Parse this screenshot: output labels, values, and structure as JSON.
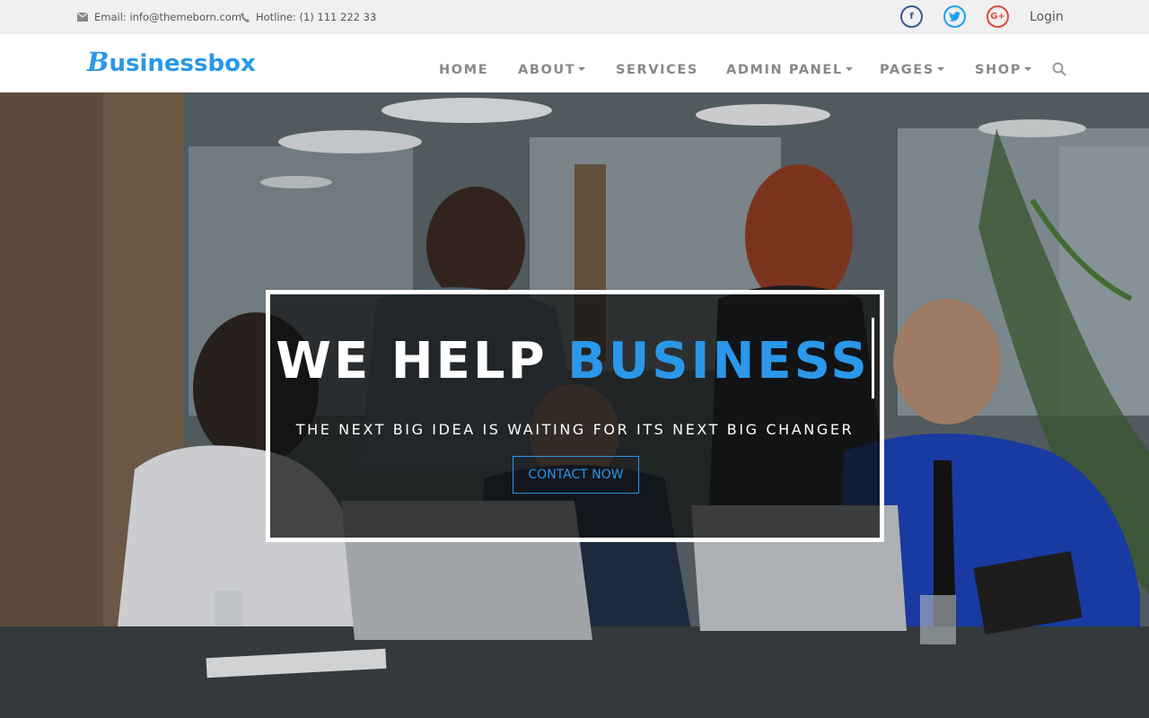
{
  "topbar": {
    "email": "Email: info@themeborn.com",
    "hotline": "Hotline: (1) 111 222 33",
    "social": [
      {
        "name": "facebook",
        "glyph": "f",
        "color": "#3b5998"
      },
      {
        "name": "twitter",
        "glyph": "t",
        "color": "#1da1f2"
      },
      {
        "name": "google-plus",
        "glyph": "G+",
        "color": "#dd4b39"
      }
    ],
    "login": "Login"
  },
  "navbar": {
    "logo_initial": "B",
    "logo_rest": "usinessbox",
    "items": [
      {
        "label": "HOME",
        "dropdown": false
      },
      {
        "label": "ABOUT",
        "dropdown": true
      },
      {
        "label": "SERVICES",
        "dropdown": false
      },
      {
        "label": "ADMIN PANEL",
        "dropdown": true
      },
      {
        "label": "PAGES",
        "dropdown": true
      },
      {
        "label": "SHOP",
        "dropdown": true
      }
    ],
    "search_icon": "search-icon"
  },
  "hero": {
    "title_white": "WE HELP ",
    "title_accent": "BUSINESS",
    "subtitle": "THE NEXT BIG IDEA IS WAITING FOR ITS NEXT BIG CHANGER",
    "button": "CONTACT NOW"
  },
  "colors": {
    "accent": "#2a97e9",
    "topbar_bg": "#f0f0f0",
    "nav_text": "#888888"
  }
}
